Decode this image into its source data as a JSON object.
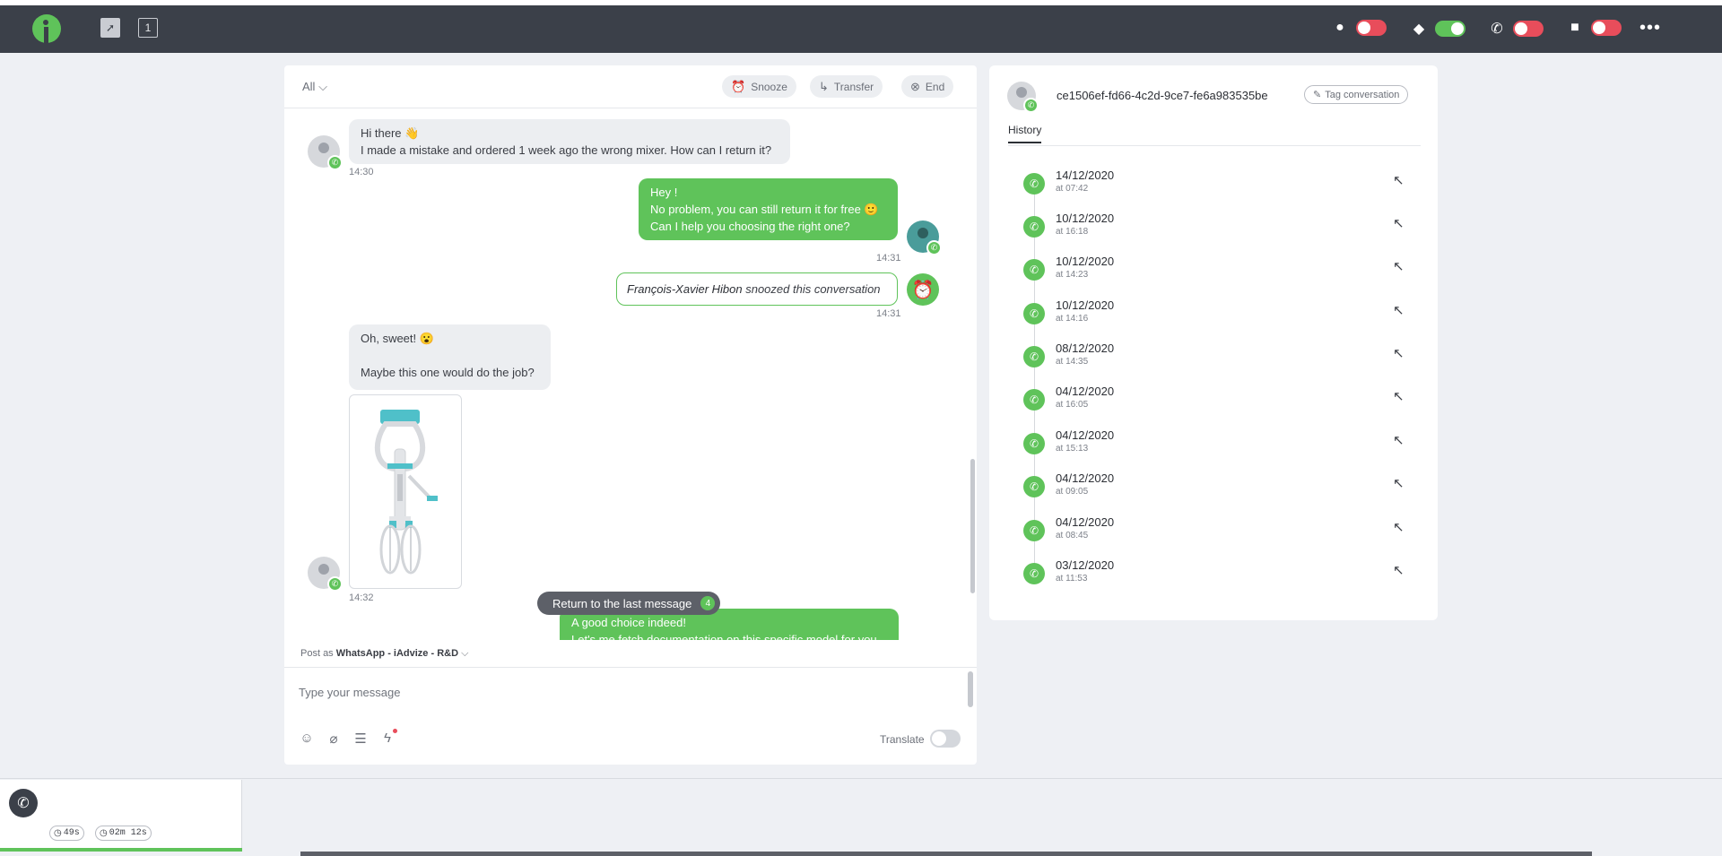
{
  "topbar": {
    "tab_count": "1",
    "toggles": [
      {
        "icon": "chat-icon",
        "glyph": "💬",
        "state": "off"
      },
      {
        "icon": "group-chat-icon",
        "glyph": "💭",
        "state": "on"
      },
      {
        "icon": "phone-icon",
        "glyph": "📞",
        "state": "off"
      },
      {
        "icon": "video-icon",
        "glyph": "📹",
        "state": "off"
      }
    ],
    "more_label": "•••"
  },
  "chat": {
    "filter_label": "All",
    "actions": {
      "snooze": "Snooze",
      "transfer": "Transfer",
      "end": "End"
    },
    "messages": {
      "m1_line1": "Hi there 👋",
      "m1_line2": "I made a mistake and ordered 1 week ago the wrong mixer. How can I return it?",
      "m1_time": "14:30",
      "m2_line1": "Hey !",
      "m2_line2": "No problem, you can still return it for free 🙂",
      "m2_line3": "Can I help you choosing the right one?",
      "m2_time": "14:31",
      "event_actor": "François-Xavier Hibon",
      "event_text": " snoozed this conversation",
      "event_time": "14:31",
      "m3_line1": "Oh, sweet! 😮",
      "m3_line2": "Maybe this one would do the job?",
      "m4_time": "14:32",
      "m5_line1": "A good choice indeed!",
      "m5_line2": "Let's me fetch documentation on this specific model for you"
    },
    "return_label": "Return to the last message",
    "return_count": "4",
    "post_as_prefix": "Post as ",
    "post_as_channel": "WhatsApp - iAdvize - R&D",
    "composer_placeholder": "Type your message",
    "translate_label": "Translate"
  },
  "side": {
    "visitor_id": "ce1506ef-fd66-4c2d-9ce7-fe6a983535be",
    "tag_label": "Tag conversation",
    "history_tab": "History",
    "history": [
      {
        "date": "14/12/2020",
        "time": "at 07:42"
      },
      {
        "date": "10/12/2020",
        "time": "at 16:18"
      },
      {
        "date": "10/12/2020",
        "time": "at 14:23"
      },
      {
        "date": "10/12/2020",
        "time": "at 14:16"
      },
      {
        "date": "08/12/2020",
        "time": "at 14:35"
      },
      {
        "date": "04/12/2020",
        "time": "at 16:05"
      },
      {
        "date": "04/12/2020",
        "time": "at 15:13"
      },
      {
        "date": "04/12/2020",
        "time": "at 09:05"
      },
      {
        "date": "04/12/2020",
        "time": "at 08:45"
      },
      {
        "date": "03/12/2020",
        "time": "at 11:53"
      }
    ]
  },
  "tray": {
    "timer_wait": "49s",
    "timer_total": "02m 12s"
  },
  "colors": {
    "accent": "#5fc35a",
    "topbar": "#3b4049",
    "toggle_off": "#e84d5b"
  }
}
